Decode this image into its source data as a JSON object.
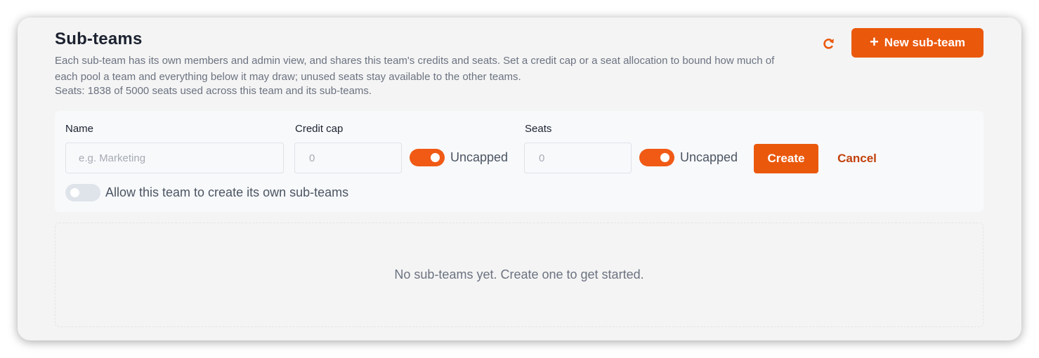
{
  "header": {
    "title": "Sub-teams",
    "description": "Each sub-team has its own members and admin view, and shares this team's credits and seats. Set a credit cap or a seat allocation to bound how much of each pool a team and everything below it may draw; unused seats stay available to the other teams.",
    "seats_summary": "Seats: 1838 of 5000 seats used across this team and its sub-teams.",
    "refresh_icon": "refresh-icon",
    "new_button_label": "New sub-team",
    "new_button_icon": "plus-icon"
  },
  "form": {
    "name": {
      "label": "Name",
      "placeholder": "e.g. Marketing",
      "value": ""
    },
    "credit_cap": {
      "label": "Credit cap",
      "placeholder": "0",
      "value": "",
      "uncapped_label": "Uncapped",
      "uncapped": true
    },
    "seats": {
      "label": "Seats",
      "placeholder": "0",
      "value": "",
      "uncapped_label": "Uncapped",
      "uncapped": true
    },
    "create_label": "Create",
    "cancel_label": "Cancel",
    "allow_subteams": {
      "label": "Allow this team to create its own sub-teams",
      "enabled": false
    }
  },
  "empty_state": {
    "message": "No sub-teams yet. Create one to get started."
  },
  "colors": {
    "accent": "#ea580c",
    "toggle_on": "#f05a14",
    "toggle_off": "#dfe3ea",
    "text_primary": "#1c2230",
    "text_muted": "#6b7280"
  }
}
